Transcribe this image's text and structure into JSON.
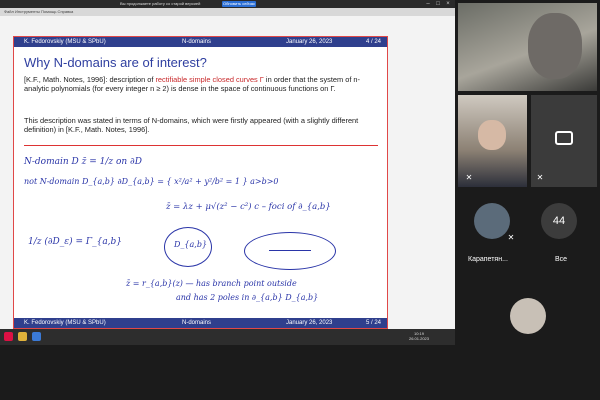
{
  "topbar": {
    "menu": "Файл   Инструменты   Помощь   Справка",
    "warning": "Вы продолжаете работу со старой версией",
    "refresh_label": "Обновить сейчас"
  },
  "slide": {
    "header": {
      "author": "K. Fedorovskiy  (MSU & SPbU)",
      "section": "N-domains",
      "date": "January 26, 2023",
      "page": "4 / 24"
    },
    "title": "Why N-domains are of interest?",
    "para1_a": "[K.F., Math. Notes, 1996]: description of ",
    "para1_hl": "rectifiable simple closed curves Γ",
    "para1_b": " in order that the system of n-analytic polynomials (for every integer n ≥ 2) is dense in the space of continuous functions on Γ.",
    "para2": "This description was stated in terms of N-domains, which were firstly appeared (with a slightly different definition) in [K.F., Math. Notes, 1996].",
    "handwriting": [
      "N-domain   D     z̄ = 1/z   on ∂D",
      "not N-domain   D_{a,b}   ∂D_{a,b} = { x²/a² + y²/b² = 1 }    a>b>0",
      "z̄ = λz + μ√(z² − c²)     c – foci of ∂_{a,b}",
      "1/z (∂D_ε) = Γ_{a,b}",
      "D_{a,b}",
      "z̄ = r_{a,b}(z) — has branch point outside",
      "and has 2 poles in ∂_{a,b} D_{a,b}"
    ],
    "footer": {
      "author": "K. Fedorovskiy  (MSU & SPbU)",
      "section": "N-domains",
      "date": "January 26, 2023",
      "page": "5 / 24"
    }
  },
  "taskbar": {
    "time": "10:19",
    "date": "26.01.2023"
  },
  "participants": [
    {
      "name": "",
      "muted": false
    },
    {
      "name": "",
      "muted": true
    },
    {
      "name": "",
      "muted": true
    },
    {
      "name": "Карапетян...",
      "muted": true
    },
    {
      "name": "Все",
      "count": "44"
    },
    {
      "name": "",
      "muted": false
    }
  ],
  "colors": {
    "slide_bar": "#2f3f8d",
    "title": "#2f3fa0",
    "highlight": "#c8282a",
    "handwriting": "#2a35a8"
  }
}
